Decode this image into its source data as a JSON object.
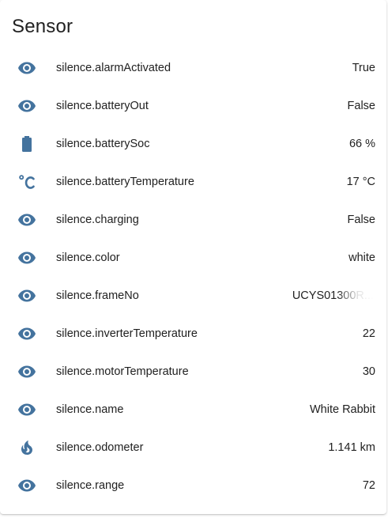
{
  "card": {
    "title": "Sensor"
  },
  "colors": {
    "icon": "#44739e",
    "text": "#212121",
    "background": "#ffffff"
  },
  "entities": [
    {
      "icon": "eye-icon",
      "name": "silence.alarmActivated",
      "state": "True"
    },
    {
      "icon": "eye-icon",
      "name": "silence.batteryOut",
      "state": "False"
    },
    {
      "icon": "battery-icon",
      "name": "silence.batterySoc",
      "state": "66 %"
    },
    {
      "icon": "thermometer-celsius-icon",
      "name": "silence.batteryTemperature",
      "state": "17 °C"
    },
    {
      "icon": "eye-icon",
      "name": "silence.charging",
      "state": "False"
    },
    {
      "icon": "eye-icon",
      "name": "silence.color",
      "state": "white"
    },
    {
      "icon": "eye-icon",
      "name": "silence.frameNo",
      "state": "UCYS01300R..."
    },
    {
      "icon": "eye-icon",
      "name": "silence.inverterTemperature",
      "state": "22"
    },
    {
      "icon": "eye-icon",
      "name": "silence.motorTemperature",
      "state": "30"
    },
    {
      "icon": "eye-icon",
      "name": "silence.name",
      "state": "White Rabbit"
    },
    {
      "icon": "fire-icon",
      "name": "silence.odometer",
      "state": "1.141 km"
    },
    {
      "icon": "eye-icon",
      "name": "silence.range",
      "state": "72"
    }
  ]
}
